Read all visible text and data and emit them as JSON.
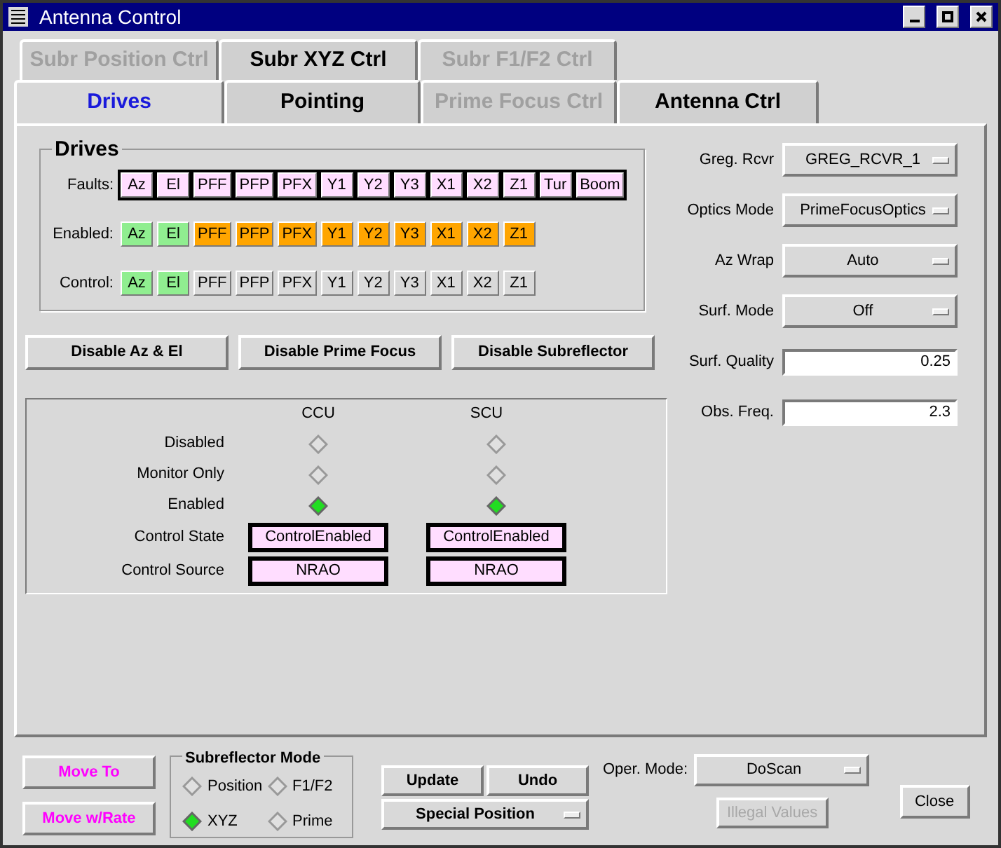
{
  "window": {
    "title": "Antenna Control"
  },
  "tab_rows": [
    [
      {
        "label": "Subr Position Ctrl",
        "selected": false,
        "disabled": true
      },
      {
        "label": "Subr XYZ Ctrl",
        "selected": false,
        "disabled": false
      },
      {
        "label": "Subr F1/F2 Ctrl",
        "selected": false,
        "disabled": true
      }
    ],
    [
      {
        "label": "Drives",
        "selected": true,
        "disabled": false
      },
      {
        "label": "Pointing",
        "selected": false,
        "disabled": false
      },
      {
        "label": "Prime Focus Ctrl",
        "selected": false,
        "disabled": true
      },
      {
        "label": "Antenna Ctrl",
        "selected": false,
        "disabled": false
      }
    ]
  ],
  "drives": {
    "title": "Drives",
    "rows": [
      {
        "label": "Faults:",
        "framed": true,
        "items": [
          {
            "label": "Az",
            "color": "#ffddff"
          },
          {
            "label": "El",
            "color": "#ffddff"
          },
          {
            "label": "PFF",
            "color": "#ffddff"
          },
          {
            "label": "PFP",
            "color": "#ffddff"
          },
          {
            "label": "PFX",
            "color": "#ffddff"
          },
          {
            "label": "Y1",
            "color": "#ffddff"
          },
          {
            "label": "Y2",
            "color": "#ffddff"
          },
          {
            "label": "Y3",
            "color": "#ffddff"
          },
          {
            "label": "X1",
            "color": "#ffddff"
          },
          {
            "label": "X2",
            "color": "#ffddff"
          },
          {
            "label": "Z1",
            "color": "#ffddff"
          },
          {
            "label": "Tur",
            "color": "#ffddff"
          },
          {
            "label": "Boom",
            "color": "#ffddff"
          }
        ]
      },
      {
        "label": "Enabled:",
        "framed": false,
        "items": [
          {
            "label": "Az",
            "color": "#90ee90"
          },
          {
            "label": "El",
            "color": "#90ee90"
          },
          {
            "label": "PFF",
            "color": "#ffa500"
          },
          {
            "label": "PFP",
            "color": "#ffa500"
          },
          {
            "label": "PFX",
            "color": "#ffa500"
          },
          {
            "label": "Y1",
            "color": "#ffa500"
          },
          {
            "label": "Y2",
            "color": "#ffa500"
          },
          {
            "label": "Y3",
            "color": "#ffa500"
          },
          {
            "label": "X1",
            "color": "#ffa500"
          },
          {
            "label": "X2",
            "color": "#ffa500"
          },
          {
            "label": "Z1",
            "color": "#ffa500"
          }
        ]
      },
      {
        "label": "Control:",
        "framed": false,
        "items": [
          {
            "label": "Az",
            "color": "#90ee90"
          },
          {
            "label": "El",
            "color": "#90ee90"
          },
          {
            "label": "PFF",
            "color": "#d9d9d9"
          },
          {
            "label": "PFP",
            "color": "#d9d9d9"
          },
          {
            "label": "PFX",
            "color": "#d9d9d9"
          },
          {
            "label": "Y1",
            "color": "#d9d9d9"
          },
          {
            "label": "Y2",
            "color": "#d9d9d9"
          },
          {
            "label": "Y3",
            "color": "#d9d9d9"
          },
          {
            "label": "X1",
            "color": "#d9d9d9"
          },
          {
            "label": "X2",
            "color": "#d9d9d9"
          },
          {
            "label": "Z1",
            "color": "#d9d9d9"
          }
        ]
      }
    ]
  },
  "disable_buttons": [
    "Disable Az & El",
    "Disable Prime Focus",
    "Disable Subreflector"
  ],
  "status": {
    "columns": [
      "CCU",
      "SCU"
    ],
    "radio_rows": [
      {
        "label": "Disabled",
        "cells": [
          {
            "selected": false
          },
          {
            "selected": false
          }
        ]
      },
      {
        "label": "Monitor Only",
        "cells": [
          {
            "selected": false
          },
          {
            "selected": false
          }
        ]
      },
      {
        "label": "Enabled",
        "cells": [
          {
            "selected": true
          },
          {
            "selected": true
          }
        ]
      }
    ],
    "value_rows": [
      {
        "label": "Control State",
        "cells": [
          "ControlEnabled",
          "ControlEnabled"
        ]
      },
      {
        "label": "Control Source",
        "cells": [
          "NRAO",
          "NRAO"
        ]
      }
    ]
  },
  "settings": [
    {
      "label": "Greg. Rcvr",
      "kind": "dropdown",
      "value": "GREG_RCVR_1"
    },
    {
      "label": "Optics Mode",
      "kind": "dropdown",
      "value": "PrimeFocusOptics"
    },
    {
      "label": "Az Wrap",
      "kind": "dropdown",
      "value": "Auto"
    },
    {
      "label": "Surf. Mode",
      "kind": "dropdown",
      "value": "Off"
    },
    {
      "label": "Surf. Quality",
      "kind": "input",
      "value": "0.25"
    },
    {
      "label": "Obs. Freq.",
      "kind": "input",
      "value": "2.3"
    }
  ],
  "move_buttons": [
    "Move To",
    "Move w/Rate"
  ],
  "subreflector_mode": {
    "title": "Subreflector Mode",
    "options": [
      {
        "label": "Position",
        "selected": false
      },
      {
        "label": "F1/F2",
        "selected": false
      },
      {
        "label": "XYZ",
        "selected": true
      },
      {
        "label": "Prime",
        "selected": false
      }
    ]
  },
  "update_button": "Update",
  "undo_button": "Undo",
  "special_position": "Special Position",
  "oper_mode": {
    "label": "Oper. Mode:",
    "value": "DoScan"
  },
  "illegal_values": {
    "label": "Illegal Values",
    "disabled": true
  },
  "close_button": "Close"
}
